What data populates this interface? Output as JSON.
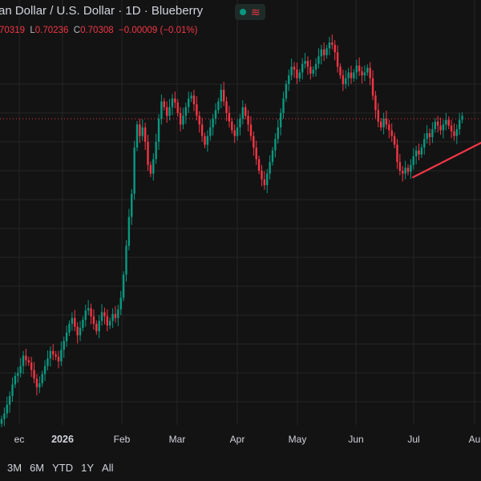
{
  "header": {
    "title": "an Dollar / U.S. Dollar · 1D · Blueberry",
    "wave_glyph": "≋"
  },
  "ohlc": {
    "open_value": "70319",
    "low_label": "L",
    "low_value": "0.70236",
    "close_label": "C",
    "close_value": "0.70308",
    "change": "−0.00009 (−0.01%)"
  },
  "time_axis_labels": [
    "ec",
    "2026",
    "Feb",
    "Mar",
    "Apr",
    "May",
    "Jun",
    "Jul",
    "Au"
  ],
  "range_buttons": [
    "3M",
    "6M",
    "YTD",
    "1Y",
    "All"
  ],
  "colors": {
    "up": "#089981",
    "down": "#f23645",
    "trendline": "#f23645",
    "background": "#131313",
    "grid": "#262626"
  },
  "chart_data": {
    "type": "candlestick",
    "note_closes": [
      [
        0.657,
        0.658,
        0.6595,
        0.661,
        0.663,
        0.6645,
        0.665,
        0.6662,
        0.668,
        0.6672,
        0.6668,
        0.6655,
        0.664,
        0.6625,
        0.6632,
        0.6648,
        0.6662,
        0.6675,
        0.6688,
        0.6682,
        0.6678,
        0.667,
        0.669,
        0.6705,
        0.672,
        0.6735,
        0.6745,
        0.673,
        0.6715,
        0.6728,
        0.6742,
        0.6758,
        0.6762,
        0.6748,
        0.6735,
        0.6722,
        0.674,
        0.6755,
        0.6748,
        0.6732,
        0.674,
        0.6752,
        0.6745,
        0.676,
        0.678,
        0.682,
        0.687,
        0.692,
        0.696,
        0.704,
        0.708,
        0.706,
        0.7075,
        0.705,
        0.701,
        0.6995,
        0.702,
        0.705,
        0.709,
        0.712,
        0.711,
        0.7095,
        0.711,
        0.7125,
        0.7118,
        0.71,
        0.708,
        0.7095,
        0.711,
        0.7125,
        0.713,
        0.7115,
        0.7095,
        0.708,
        0.706,
        0.7045,
        0.706,
        0.7075,
        0.709,
        0.7105,
        0.712,
        0.714,
        0.712,
        0.71,
        0.7085,
        0.707,
        0.706,
        0.7075,
        0.709,
        0.711,
        0.7095,
        0.708,
        0.706,
        0.704,
        0.702,
        0.7,
        0.6985,
        0.6975,
        0.6995,
        0.7015,
        0.7035,
        0.7055,
        0.7075,
        0.71,
        0.7125,
        0.715,
        0.7165,
        0.718,
        0.7175,
        0.716,
        0.717,
        0.7185,
        0.719,
        0.718,
        0.7168,
        0.7175,
        0.7185,
        0.7198,
        0.721,
        0.72,
        0.7212,
        0.7222,
        0.7218,
        0.7205,
        0.718,
        0.7165,
        0.715,
        0.716,
        0.717,
        0.716,
        0.717,
        0.7182,
        0.7172,
        0.7165,
        0.717,
        0.7178,
        0.716,
        0.713,
        0.7105,
        0.7085,
        0.7075,
        0.709,
        0.708,
        0.707,
        0.706,
        0.7045,
        0.7015,
        0.7,
        0.6995,
        0.7005,
        0.6998,
        0.701,
        0.7025,
        0.7035,
        0.7028,
        0.704,
        0.7055,
        0.7065,
        0.7058,
        0.7072,
        0.7085,
        0.7078,
        0.707,
        0.708,
        0.7088,
        0.7078,
        0.7068,
        0.706,
        0.7072,
        0.7088,
        0.7095
      ]
    ],
    "y_grid_ticks": [
      0.715,
      0.71,
      0.705,
      0.7,
      0.695,
      0.69,
      0.685,
      0.68,
      0.675,
      0.67,
      0.665,
      0.66
    ],
    "ylim": [
      0.656,
      0.724
    ],
    "trendline": [
      [
        140,
        0.6997
      ],
      [
        181,
        0.7058
      ]
    ],
    "grid": true
  }
}
